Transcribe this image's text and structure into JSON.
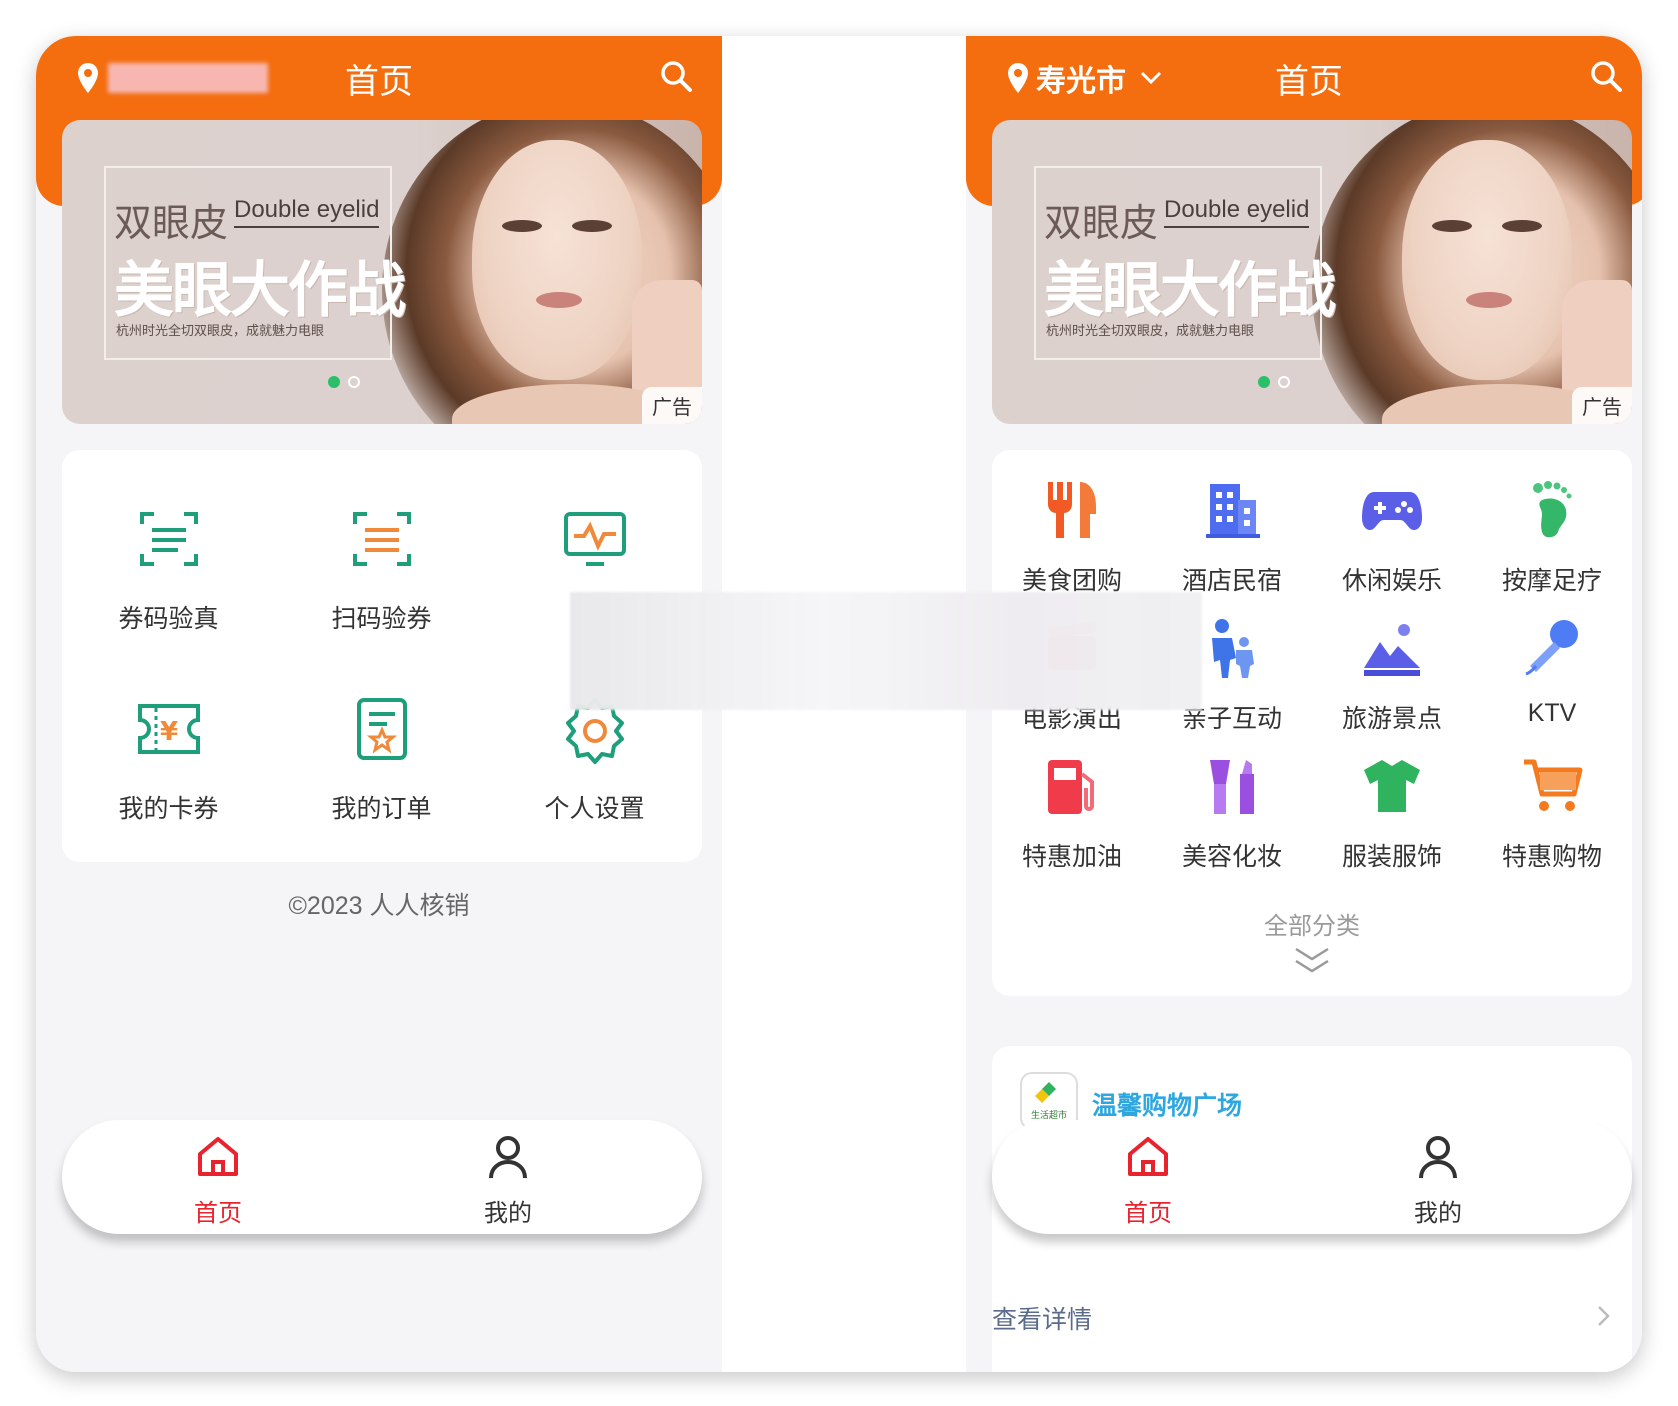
{
  "left_screen": {
    "header": {
      "title": "首页",
      "city": ""
    },
    "banner": {
      "title_cn": "双眼皮",
      "title_en": "Double eyelid",
      "headline": "美眼大作战",
      "subtitle": "杭州时光全切双眼皮，成就魅力电眼",
      "ad_tag": "广告",
      "active_dot": 1,
      "dot_count": 2
    },
    "functions": [
      {
        "label": "券码验真",
        "icon": "coupon-scan-icon"
      },
      {
        "label": "扫码验券",
        "icon": "scan-verify-icon"
      },
      {
        "label": "",
        "icon": "monitor-icon"
      },
      {
        "label": "我的卡券",
        "icon": "ticket-icon"
      },
      {
        "label": "我的订单",
        "icon": "order-icon"
      },
      {
        "label": "个人设置",
        "icon": "settings-icon"
      }
    ],
    "copyright": "©2023 人人核销",
    "tabbar": {
      "home": "首页",
      "mine": "我的"
    }
  },
  "right_screen": {
    "header": {
      "title": "首页",
      "city": "寿光市"
    },
    "banner": {
      "title_cn": "双眼皮",
      "title_en": "Double eyelid",
      "headline": "美眼大作战",
      "subtitle": "杭州时光全切双眼皮，成就魅力电眼",
      "ad_tag": "广告",
      "active_dot": 1,
      "dot_count": 2
    },
    "categories": [
      {
        "label": "美食团购",
        "icon": "fork-knife-icon",
        "color": "#f15a24"
      },
      {
        "label": "酒店民宿",
        "icon": "hotel-icon",
        "color": "#4e6cf0"
      },
      {
        "label": "休闲娱乐",
        "icon": "gamepad-icon",
        "color": "#5b5fe8"
      },
      {
        "label": "按摩足疗",
        "icon": "foot-icon",
        "color": "#35b76a"
      },
      {
        "label": "电影演出",
        "icon": "movie-icon",
        "color": "#f0506e"
      },
      {
        "label": "亲子互动",
        "icon": "parent-child-icon",
        "color": "#3f73e8"
      },
      {
        "label": "旅游景点",
        "icon": "mountain-icon",
        "color": "#5b5fe8"
      },
      {
        "label": "KTV",
        "icon": "microphone-icon",
        "color": "#4d7cf5"
      },
      {
        "label": "特惠加油",
        "icon": "gas-station-icon",
        "color": "#ef3b4a"
      },
      {
        "label": "美容化妆",
        "icon": "cosmetics-icon",
        "color": "#9b4fe0"
      },
      {
        "label": "服装服饰",
        "icon": "tshirt-icon",
        "color": "#2fb35e"
      },
      {
        "label": "特惠购物",
        "icon": "cart-icon",
        "color": "#f47a1f"
      }
    ],
    "all_categories": "全部分类",
    "shop": {
      "name": "温馨购物广场",
      "logo_text": "生活超市"
    },
    "detail_link": "查看详情",
    "tabbar": {
      "home": "首页",
      "mine": "我的"
    }
  },
  "colors": {
    "header": "#f46d0f",
    "active_tab": "#e8232e",
    "function_green": "#1e9e7a",
    "function_orange": "#f08a3a",
    "shop_name": "#2ea7e0"
  }
}
